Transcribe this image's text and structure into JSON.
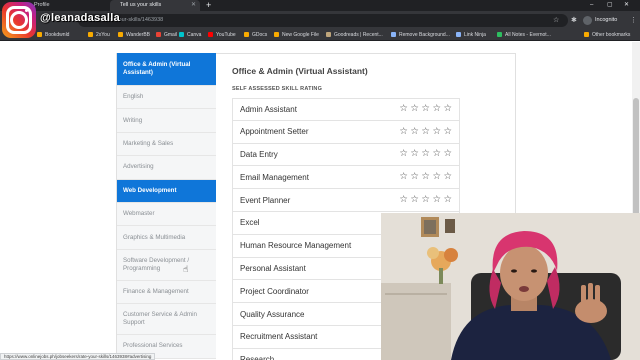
{
  "browser": {
    "tabs": [
      {
        "label": "Profile"
      },
      {
        "label": "Tell us your skills"
      }
    ],
    "new_tab": "+",
    "window_controls": [
      "–",
      "▢",
      "✕"
    ],
    "url": "...kers/rate-your-skills/1463938",
    "incognito_label": "Incognito",
    "bookmarks": [
      {
        "label": "Bookdwnld",
        "color": "#f9ab00"
      },
      {
        "label": "2xYou",
        "color": "#f9ab00"
      },
      {
        "label": "WanderBB",
        "color": "#f9ab00"
      },
      {
        "label": "Gmail",
        "color": "#ea4335"
      },
      {
        "label": "Canva",
        "color": "#00c4cc"
      },
      {
        "label": "YouTube",
        "color": "#ff0000"
      },
      {
        "label": "GDocs",
        "color": "#f9ab00"
      },
      {
        "label": "New Google File",
        "color": "#f9ab00"
      },
      {
        "label": "Goodreads | Recent...",
        "color": "#bfa57b"
      },
      {
        "label": "Remove Background...",
        "color": "#8ab4f8"
      },
      {
        "label": "Link Ninja",
        "color": "#8ab4f8"
      },
      {
        "label": "All Notes - Evernot...",
        "color": "#2dbe60"
      },
      {
        "label": "Other bookmarks",
        "color": "#f9ab00"
      }
    ]
  },
  "overlay": {
    "handle": "@leanadasalla"
  },
  "sidebar": {
    "items": [
      {
        "label": "Office & Admin (Virtual Assistant)",
        "active": true
      },
      {
        "label": "English",
        "active": false
      },
      {
        "label": "Writing",
        "active": false
      },
      {
        "label": "Marketing & Sales",
        "active": false
      },
      {
        "label": "Advertising",
        "active": false
      },
      {
        "label": "Web Development",
        "active": true
      },
      {
        "label": "Webmaster",
        "active": false
      },
      {
        "label": "Graphics & Multimedia",
        "active": false
      },
      {
        "label": "Software Development / Programming",
        "active": false
      },
      {
        "label": "Finance & Management",
        "active": false
      },
      {
        "label": "Customer Service & Admin Support",
        "active": false
      },
      {
        "label": "Professional Services",
        "active": false
      }
    ]
  },
  "main": {
    "title": "Office & Admin (Virtual Assistant)",
    "subtitle": "SELF ASSESSED SKILL RATING",
    "skills": [
      {
        "name": "Admin Assistant",
        "rating": 0
      },
      {
        "name": "Appointment Setter",
        "rating": 0
      },
      {
        "name": "Data Entry",
        "rating": 0
      },
      {
        "name": "Email Management",
        "rating": 0
      },
      {
        "name": "Event Planner",
        "rating": 0
      },
      {
        "name": "Excel",
        "rating": 0
      },
      {
        "name": "Human Resource Management",
        "rating": 0
      },
      {
        "name": "Personal Assistant",
        "rating": 0
      },
      {
        "name": "Project Coordinator",
        "rating": 0
      },
      {
        "name": "Quality Assurance",
        "rating": 0
      },
      {
        "name": "Recruitment Assistant",
        "rating": 0
      },
      {
        "name": "Research",
        "rating": 0
      }
    ],
    "max_rating": 5
  },
  "status_bar_url": "https://www.onlinejobs.ph/jobseekers/rate-your-skills/1463938#advertising",
  "colors": {
    "accent": "#0f76d9"
  }
}
